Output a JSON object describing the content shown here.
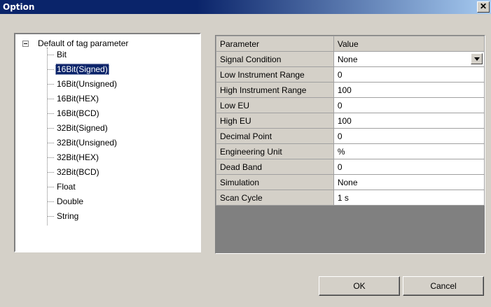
{
  "window": {
    "title": "Option",
    "close_glyph": "✕"
  },
  "tree": {
    "root": "Default of tag parameter",
    "items": [
      "Bit",
      "16Bit(Signed)",
      "16Bit(Unsigned)",
      "16Bit(HEX)",
      "16Bit(BCD)",
      "32Bit(Signed)",
      "32Bit(Unsigned)",
      "32Bit(HEX)",
      "32Bit(BCD)",
      "Float",
      "Double",
      "String"
    ],
    "selected": "16Bit(Signed)"
  },
  "grid": {
    "header": {
      "parameter": "Parameter",
      "value": "Value"
    },
    "rows": [
      {
        "parameter": "Signal Condition",
        "value": "None"
      },
      {
        "parameter": "Low Instrument Range",
        "value": "0"
      },
      {
        "parameter": "High Instrument Range",
        "value": "100"
      },
      {
        "parameter": "Low EU",
        "value": "0"
      },
      {
        "parameter": "High EU",
        "value": "100"
      },
      {
        "parameter": "Decimal Point",
        "value": "0"
      },
      {
        "parameter": "Engineering Unit",
        "value": "%"
      },
      {
        "parameter": "Dead Band",
        "value": "0"
      },
      {
        "parameter": "Simulation",
        "value": "None"
      },
      {
        "parameter": "Scan Cycle",
        "value": "1 s"
      }
    ]
  },
  "buttons": {
    "ok": "OK",
    "cancel": "Cancel"
  }
}
